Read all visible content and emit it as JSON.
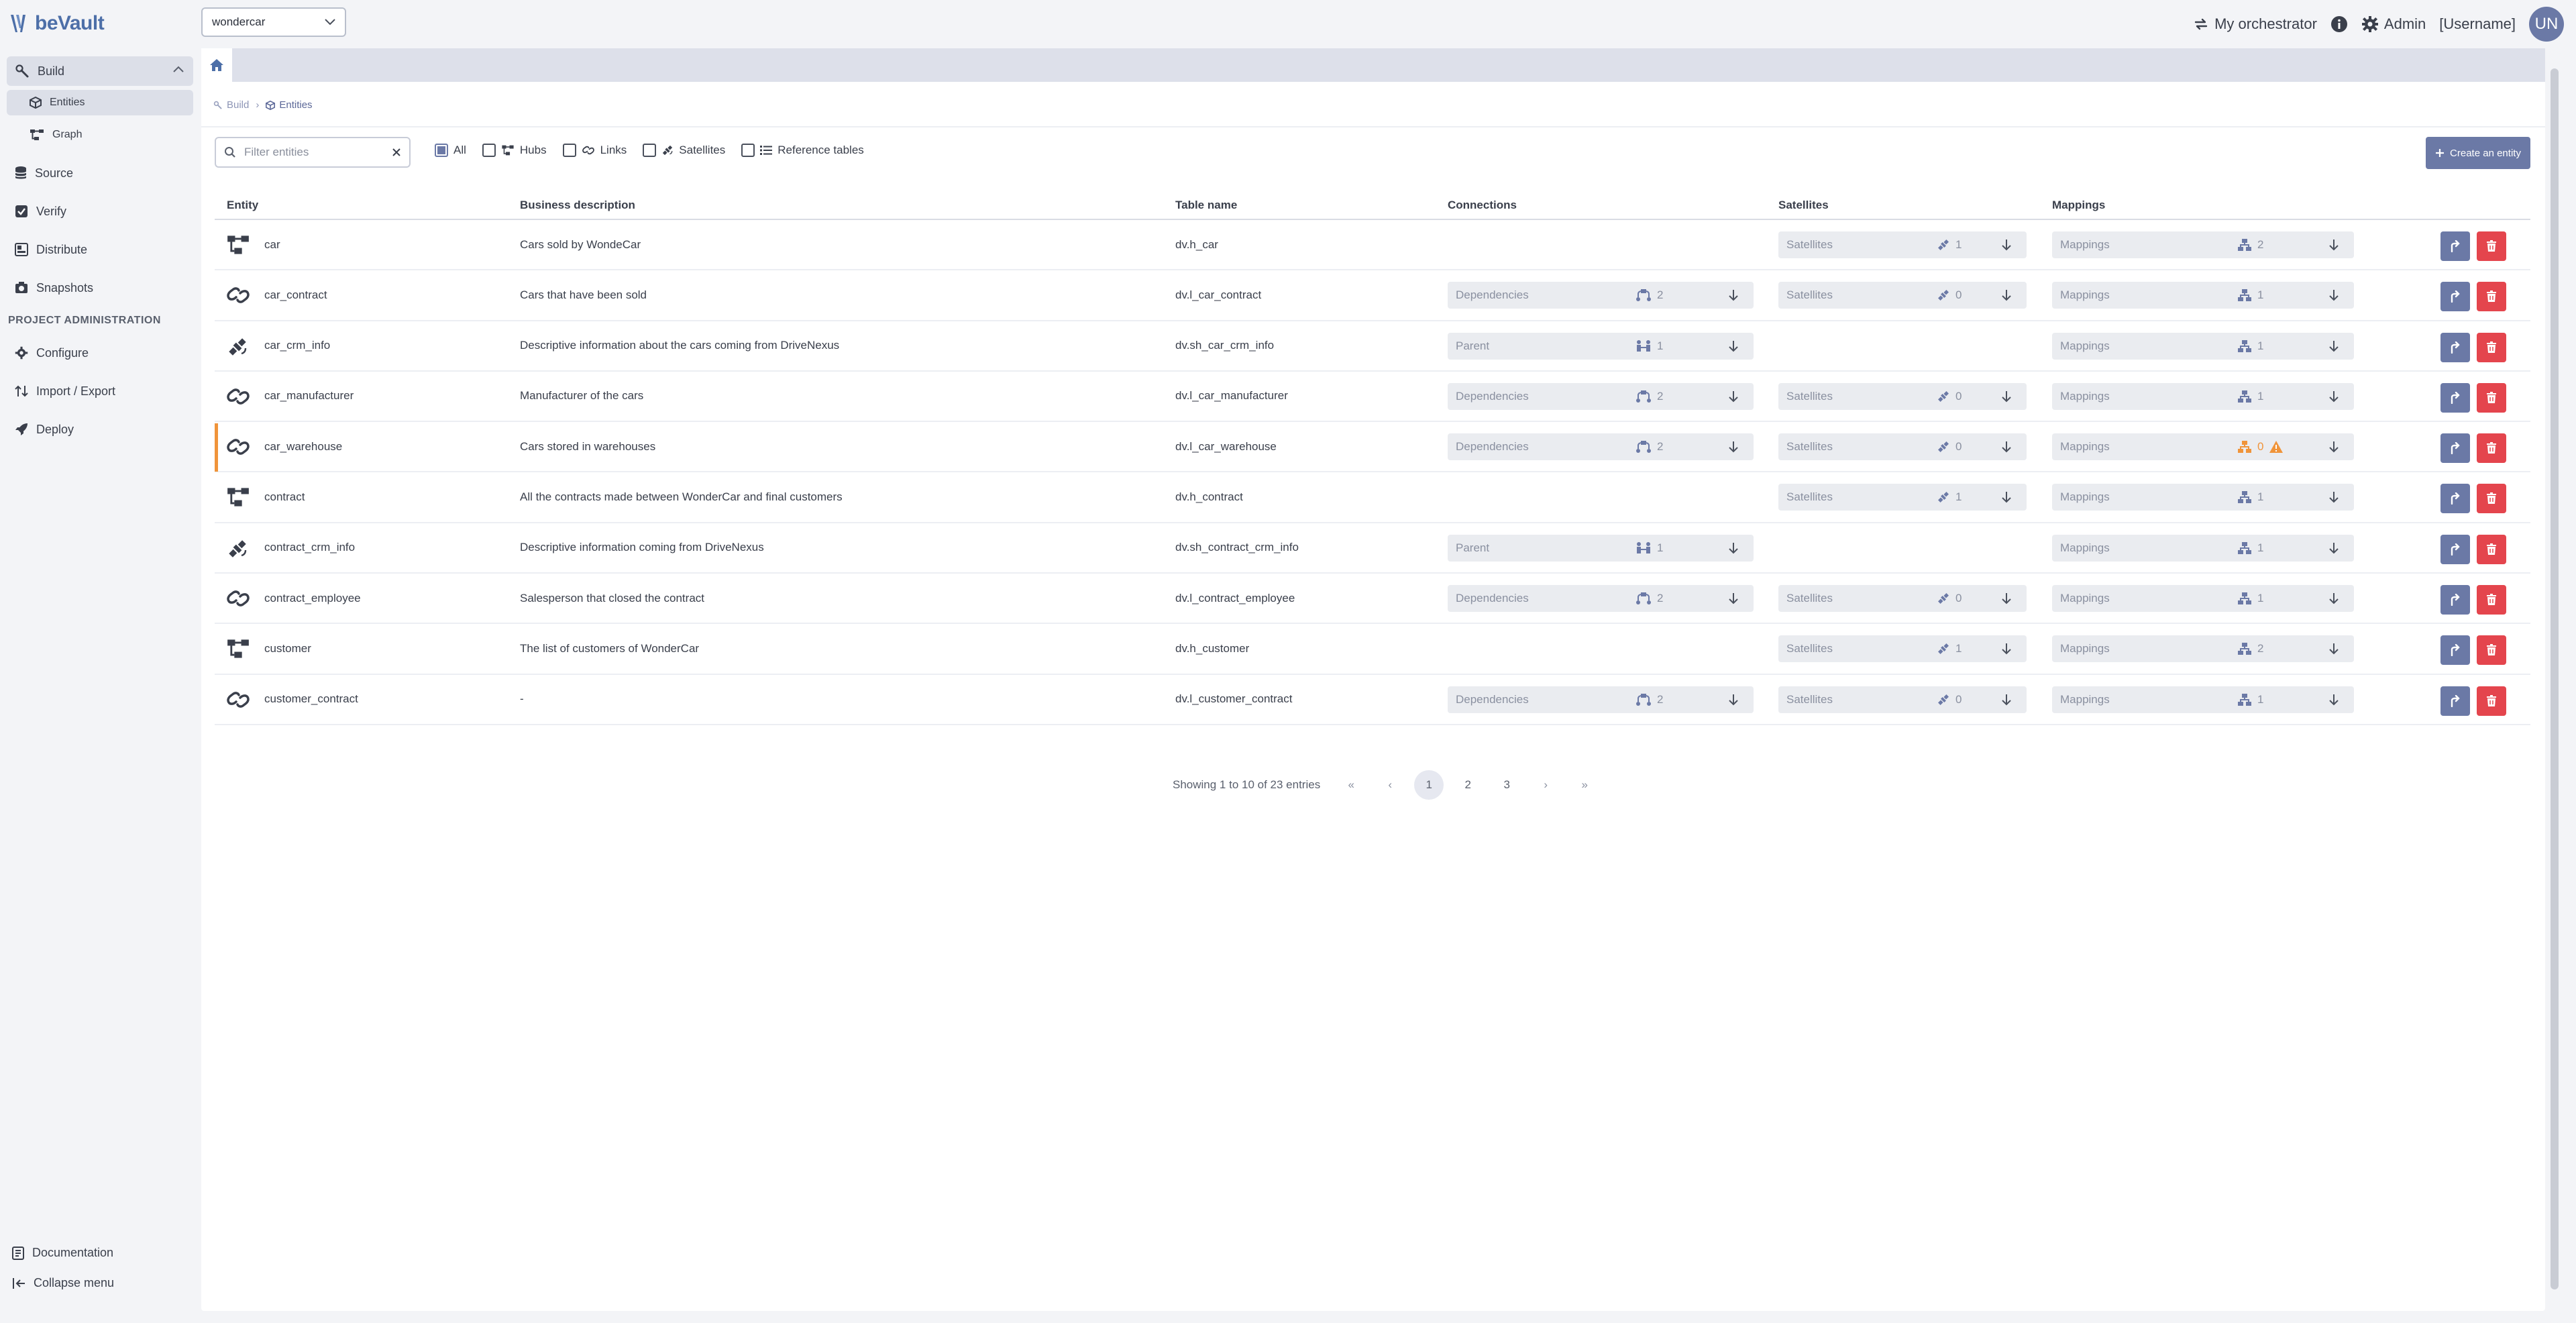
{
  "app": {
    "logo_text": "beVault"
  },
  "project_select": {
    "value": "wondercar"
  },
  "topbar": {
    "orchestrator_label": "My orchestrator",
    "admin_label": "Admin",
    "username": "[Username]",
    "avatar_initials": "UN"
  },
  "sidebar": {
    "build": "Build",
    "entities": "Entities",
    "graph": "Graph",
    "source": "Source",
    "verify": "Verify",
    "distribute": "Distribute",
    "snapshots": "Snapshots",
    "section_title": "PROJECT ADMINISTRATION",
    "configure": "Configure",
    "import_export": "Import / Export",
    "deploy": "Deploy",
    "documentation": "Documentation",
    "collapse": "Collapse menu"
  },
  "breadcrumb": {
    "build": "Build",
    "entities": "Entities"
  },
  "toolbar": {
    "filter_placeholder": "Filter entities",
    "types": [
      "All",
      "Hubs",
      "Links",
      "Satellites",
      "Reference tables"
    ],
    "create_label": "Create an entity"
  },
  "table": {
    "headers": [
      "Entity",
      "Business description",
      "Table name",
      "Connections",
      "Satellites",
      "Mappings"
    ],
    "pill_labels": {
      "dependencies": "Dependencies",
      "parent": "Parent",
      "satellites": "Satellites",
      "mappings": "Mappings"
    },
    "rows": [
      {
        "type": "hub",
        "name": "car",
        "description": "Cars sold by WondeCar",
        "table_name": "dv.h_car",
        "conn_type": "",
        "conn_count": "",
        "sat_count": "1",
        "map_count": "2",
        "flag": false
      },
      {
        "type": "link",
        "name": "car_contract",
        "description": "Cars that have been sold",
        "table_name": "dv.l_car_contract",
        "conn_type": "dependencies",
        "conn_count": "2",
        "sat_count": "0",
        "map_count": "1",
        "flag": false
      },
      {
        "type": "satellite",
        "name": "car_crm_info",
        "description": "Descriptive information about the cars coming from DriveNexus",
        "table_name": "dv.sh_car_crm_info",
        "conn_type": "parent",
        "conn_count": "1",
        "sat_count": "",
        "map_count": "1",
        "flag": false
      },
      {
        "type": "link",
        "name": "car_manufacturer",
        "description": "Manufacturer of the cars",
        "table_name": "dv.l_car_manufacturer",
        "conn_type": "dependencies",
        "conn_count": "2",
        "sat_count": "0",
        "map_count": "1",
        "flag": false
      },
      {
        "type": "link",
        "name": "car_warehouse",
        "description": "Cars stored in warehouses",
        "table_name": "dv.l_car_warehouse",
        "conn_type": "dependencies",
        "conn_count": "2",
        "sat_count": "0",
        "map_count": "0",
        "flag": true
      },
      {
        "type": "hub",
        "name": "contract",
        "description": "All the contracts made between WonderCar and final customers",
        "table_name": "dv.h_contract",
        "conn_type": "",
        "conn_count": "",
        "sat_count": "1",
        "map_count": "1",
        "flag": false
      },
      {
        "type": "satellite",
        "name": "contract_crm_info",
        "description": "Descriptive information coming from DriveNexus",
        "table_name": "dv.sh_contract_crm_info",
        "conn_type": "parent",
        "conn_count": "1",
        "sat_count": "",
        "map_count": "1",
        "flag": false
      },
      {
        "type": "link",
        "name": "contract_employee",
        "description": "Salesperson that closed the contract",
        "table_name": "dv.l_contract_employee",
        "conn_type": "dependencies",
        "conn_count": "2",
        "sat_count": "0",
        "map_count": "1",
        "flag": false
      },
      {
        "type": "hub",
        "name": "customer",
        "description": "The list of customers of WonderCar",
        "table_name": "dv.h_customer",
        "conn_type": "",
        "conn_count": "",
        "sat_count": "1",
        "map_count": "2",
        "flag": false
      },
      {
        "type": "link",
        "name": "customer_contract",
        "description": "-",
        "table_name": "dv.l_customer_contract",
        "conn_type": "dependencies",
        "conn_count": "2",
        "sat_count": "0",
        "map_count": "1",
        "flag": false
      }
    ]
  },
  "pagination": {
    "info": "Showing 1 to 10 of 23 entries",
    "pages": [
      "1",
      "2",
      "3"
    ],
    "current": "1",
    "first": "«",
    "prev": "‹",
    "next": "›",
    "last": "»"
  },
  "colors": {
    "accent": "#6b79a6",
    "danger": "#e4454d",
    "warning": "#f0943a",
    "logo": "#4d6fa8"
  }
}
